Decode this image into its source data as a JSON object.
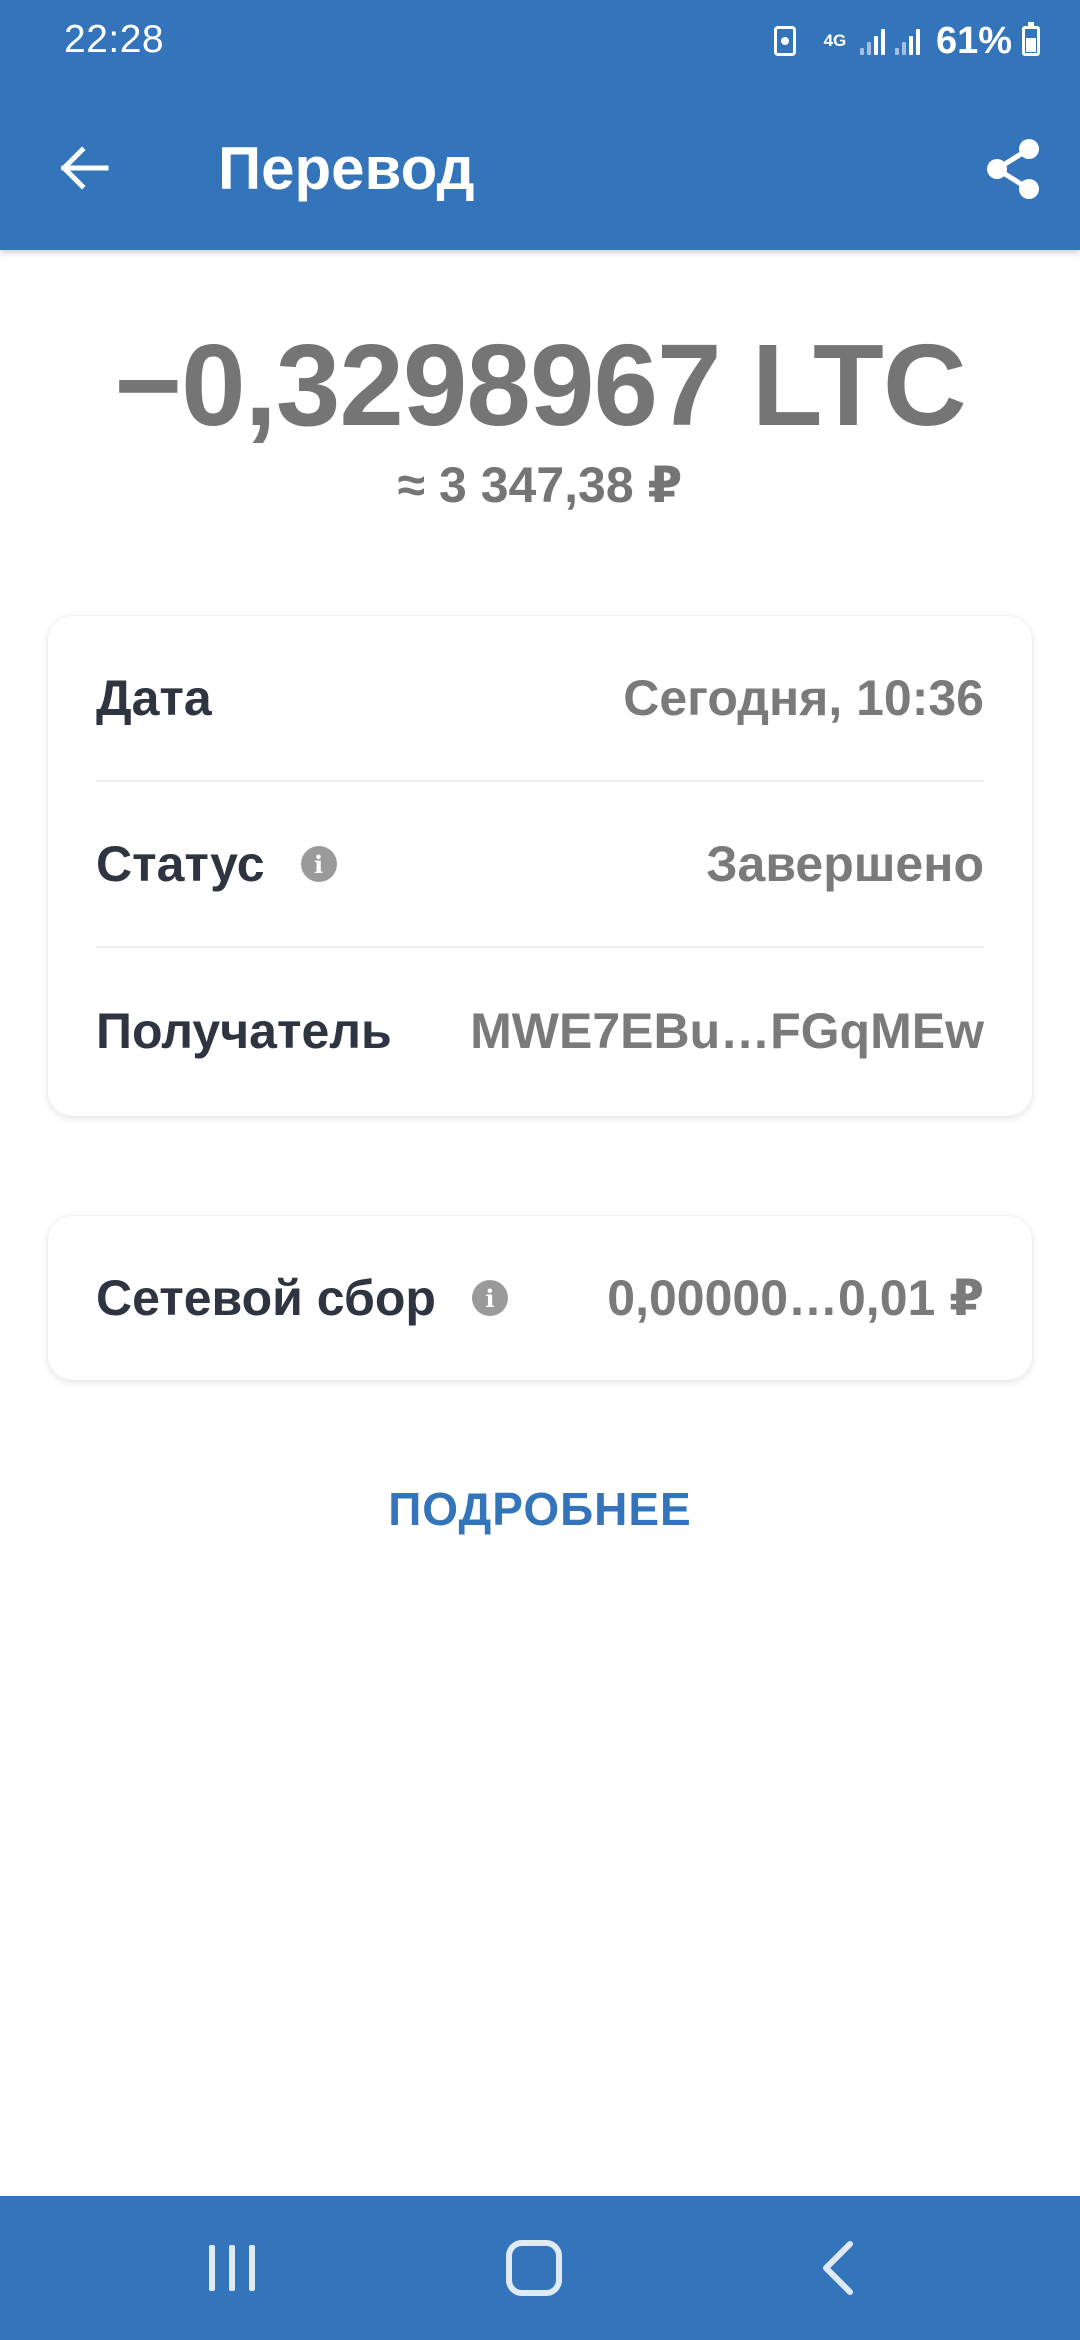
{
  "status_bar": {
    "time": "22:28",
    "network": "4G",
    "battery_percent": "61%"
  },
  "app_bar": {
    "title": "Перевод",
    "back_icon": "arrow-left-icon",
    "share_icon": "share-icon"
  },
  "transaction": {
    "amount": "−0,3298967 LTC",
    "fiat_amount": "≈ 3 347,38 ₽"
  },
  "details": {
    "rows": [
      {
        "label": "Дата",
        "value": "Сегодня, 10:36"
      },
      {
        "label": "Статус",
        "value": "Завершено"
      },
      {
        "label": "Получатель",
        "value": "MWE7EBu…FGqMEw"
      }
    ]
  },
  "fee": {
    "label": "Сетевой сбор",
    "value": "0,00000…0,01 ₽"
  },
  "more_link": "ПОДРОБНЕЕ",
  "colors": {
    "primary": "#3374BB",
    "amount_gray": "#757575",
    "label_dark": "#2E3440",
    "value_gray": "#7A7A7A"
  }
}
